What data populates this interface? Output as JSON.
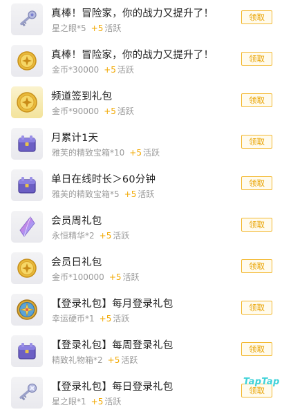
{
  "colors": {
    "accent": "#f2a800",
    "button_border": "#f3b72c",
    "title_text": "#222222",
    "sub_text": "#9a9a9a",
    "watermark": "#3fd2d8"
  },
  "tasks": [
    {
      "icon": "star-eye-key-icon",
      "title": "真棒！冒险家，你的战力又提升了！",
      "reward": "星之眼*5",
      "points": "+5",
      "points_label": "活跃",
      "button": "领取"
    },
    {
      "icon": "gold-coin-icon",
      "title": "真棒！冒险家，你的战力又提升了！",
      "reward": "金币*30000",
      "points": "+5",
      "points_label": "活跃",
      "button": "领取"
    },
    {
      "icon": "gold-coin-icon",
      "title": "频道签到礼包",
      "reward": "金币*90000",
      "points": "+5",
      "points_label": "活跃",
      "button": "领取"
    },
    {
      "icon": "treasure-chest-icon",
      "title": "月累计1天",
      "reward": "雅芙的精致宝箱*10",
      "points": "+5",
      "points_label": "活跃",
      "button": "领取"
    },
    {
      "icon": "treasure-chest-icon",
      "title": "单日在线时长＞60分钟",
      "reward": "雅芙的精致宝箱*5",
      "points": "+5",
      "points_label": "活跃",
      "button": "领取"
    },
    {
      "icon": "eternal-essence-crystal-icon",
      "title": "会员周礼包",
      "reward": "永恒精华*2",
      "points": "+5",
      "points_label": "活跃",
      "button": "领取"
    },
    {
      "icon": "gold-coin-icon",
      "title": "会员日礼包",
      "reward": "金币*100000",
      "points": "+5",
      "points_label": "活跃",
      "button": "领取"
    },
    {
      "icon": "lucky-coin-icon",
      "title": "【登录礼包】每月登录礼包",
      "reward": "幸运硬币*1",
      "points": "+5",
      "points_label": "活跃",
      "button": "领取"
    },
    {
      "icon": "gift-box-icon",
      "title": "【登录礼包】每周登录礼包",
      "reward": "精致礼物箱*2",
      "points": "+5",
      "points_label": "活跃",
      "button": "领取"
    },
    {
      "icon": "star-eye-key-icon",
      "title": "【登录礼包】每日登录礼包",
      "reward": "星之眼*1",
      "points": "+5",
      "points_label": "活跃",
      "button": "领取"
    }
  ],
  "watermark": "TapTap"
}
